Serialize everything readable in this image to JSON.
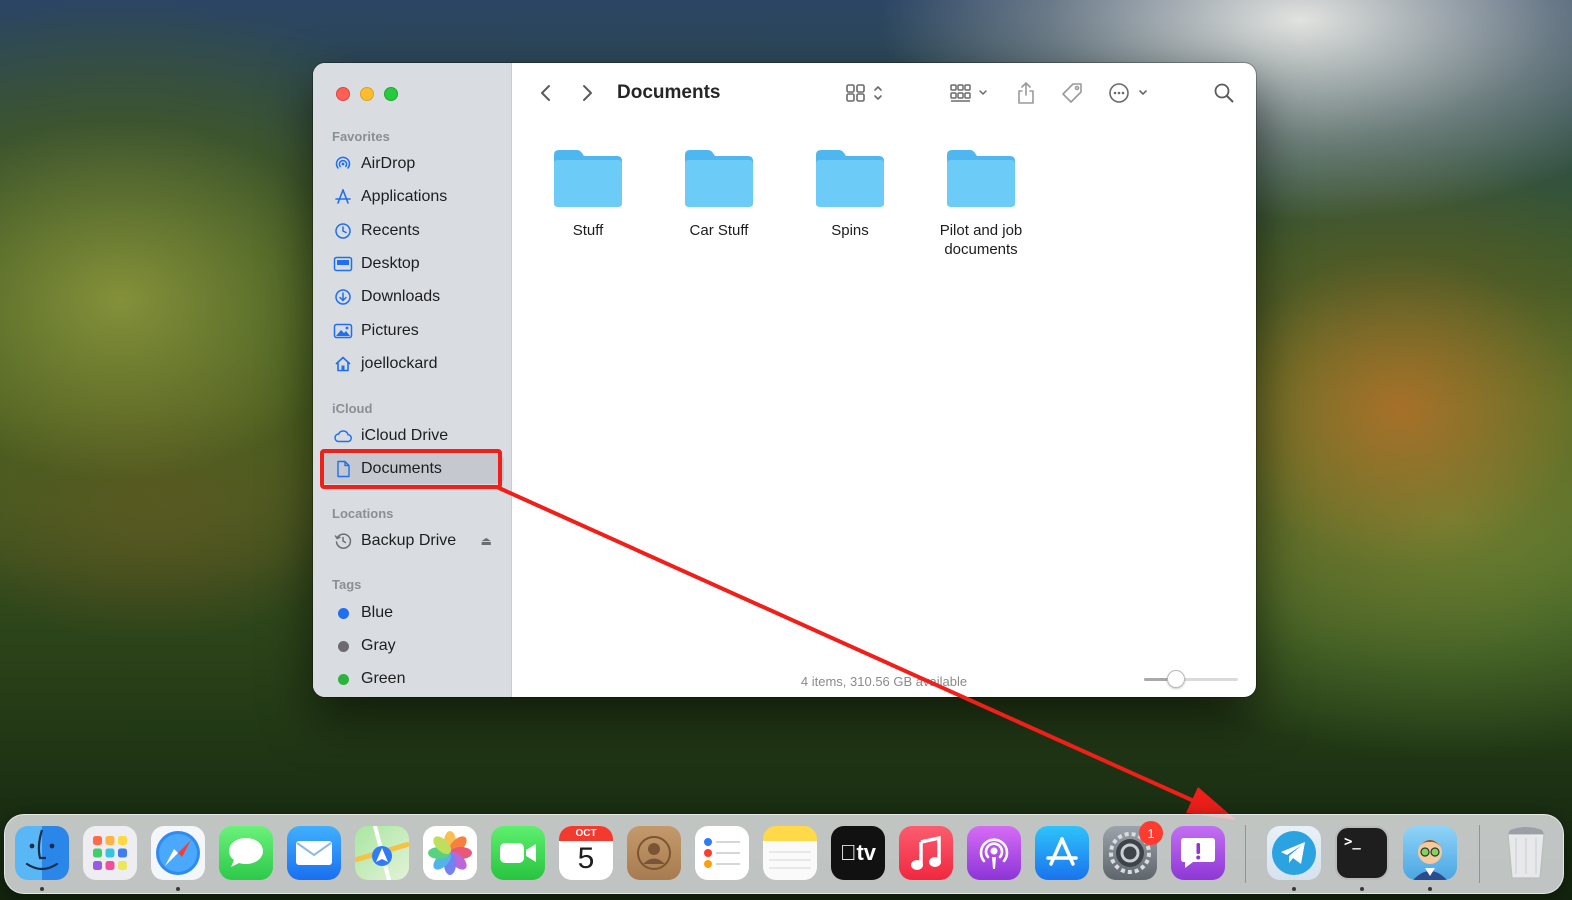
{
  "window": {
    "title": "Documents",
    "status_text": "4 items, 310.56 GB available",
    "icon_size_level": 0.3
  },
  "sidebar": {
    "favorites_title": "Favorites",
    "favorites": [
      {
        "label": "AirDrop",
        "icon": "airdrop-icon"
      },
      {
        "label": "Applications",
        "icon": "applications-icon"
      },
      {
        "label": "Recents",
        "icon": "clock-icon"
      },
      {
        "label": "Desktop",
        "icon": "desktop-icon"
      },
      {
        "label": "Downloads",
        "icon": "download-icon"
      },
      {
        "label": "Pictures",
        "icon": "photo-icon"
      },
      {
        "label": "joellockard",
        "icon": "home-icon"
      }
    ],
    "icloud_title": "iCloud",
    "icloud": [
      {
        "label": "iCloud Drive",
        "icon": "cloud-icon"
      },
      {
        "label": "Documents",
        "icon": "document-icon"
      }
    ],
    "locations_title": "Locations",
    "locations": [
      {
        "label": "Backup Drive",
        "icon": "time-machine-icon"
      }
    ],
    "tags_title": "Tags",
    "tags": [
      {
        "label": "Blue",
        "color": "#1f6ff0"
      },
      {
        "label": "Gray",
        "color": "#8e8e93"
      },
      {
        "label": "Green",
        "color": "#2cb33e"
      }
    ]
  },
  "folders": [
    {
      "name": "Stuff"
    },
    {
      "name": "Car Stuff"
    },
    {
      "name": "Spins"
    },
    {
      "name": "Pilot and job documents"
    }
  ],
  "dock": {
    "apps": [
      {
        "name": "Finder",
        "running": true
      },
      {
        "name": "Launchpad",
        "running": false
      },
      {
        "name": "Safari",
        "running": true
      },
      {
        "name": "Messages",
        "running": false
      },
      {
        "name": "Mail",
        "running": false
      },
      {
        "name": "Maps",
        "running": false
      },
      {
        "name": "Photos",
        "running": false
      },
      {
        "name": "FaceTime",
        "running": false
      },
      {
        "name": "Calendar",
        "running": false
      },
      {
        "name": "Contacts",
        "running": false
      },
      {
        "name": "Reminders",
        "running": false
      },
      {
        "name": "Notes",
        "running": false
      },
      {
        "name": "TV",
        "running": false
      },
      {
        "name": "Music",
        "running": false
      },
      {
        "name": "Podcasts",
        "running": false
      },
      {
        "name": "App Store",
        "running": false
      },
      {
        "name": "System Settings",
        "running": false
      },
      {
        "name": "Feedback Assistant",
        "running": false
      },
      {
        "name": "Telegram",
        "running": true
      },
      {
        "name": "Terminal",
        "running": true
      },
      {
        "name": "Avatar App",
        "running": true
      },
      {
        "name": "Trash",
        "running": false
      }
    ],
    "calendar_month": "OCT",
    "calendar_day": "5",
    "settings_badge": "1",
    "tv_label": "tv",
    "terminal_prompt": ">_"
  },
  "colors": {
    "accent": "#1f6ff0",
    "annotation": "#ef1f1a",
    "folder": "#5ec3f6"
  }
}
